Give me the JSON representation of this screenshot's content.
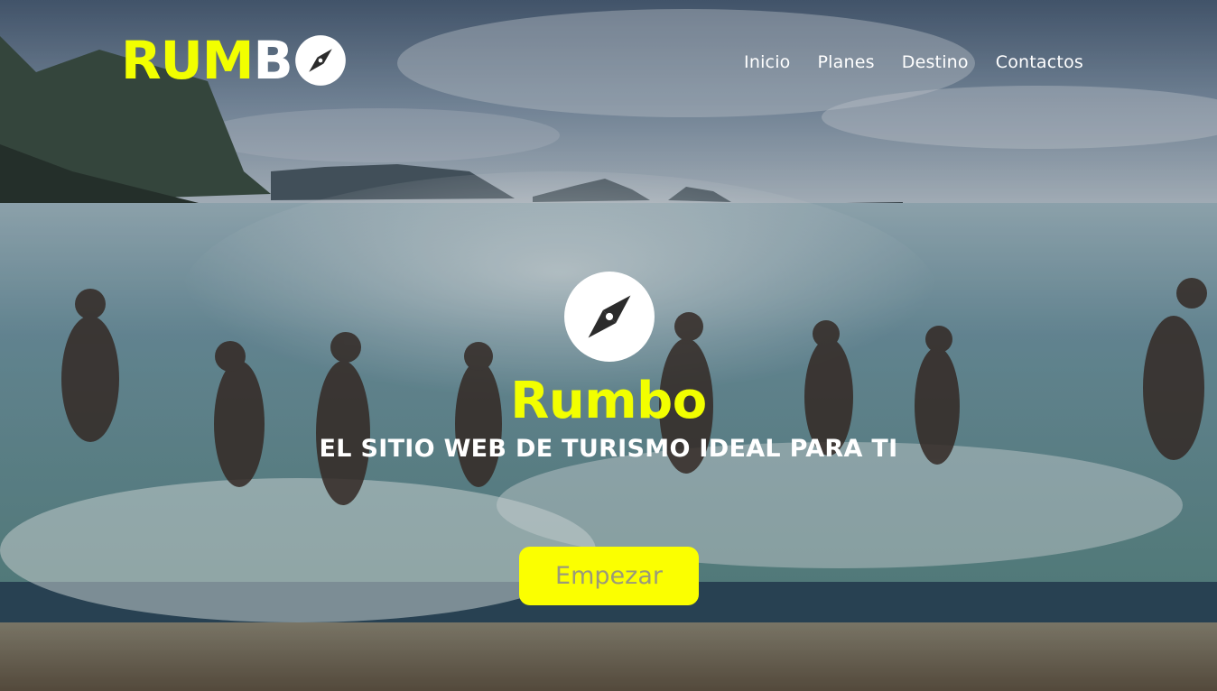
{
  "header": {
    "logo": {
      "part_accent": "RUM",
      "part_light": "B",
      "icon": "compass-icon"
    },
    "nav": [
      {
        "label": "Inicio"
      },
      {
        "label": "Planes"
      },
      {
        "label": "Destino"
      },
      {
        "label": "Contactos"
      }
    ]
  },
  "hero": {
    "icon": "compass-icon",
    "title": "Rumbo",
    "tagline": "EL SITIO WEB DE TURISMO IDEAL PARA TI",
    "cta_label": "Empezar",
    "background": "photo of people running into the sea at a beach"
  },
  "colors": {
    "accent_yellow": "#f2ff00",
    "button_yellow": "#fbff00",
    "white": "#ffffff"
  }
}
